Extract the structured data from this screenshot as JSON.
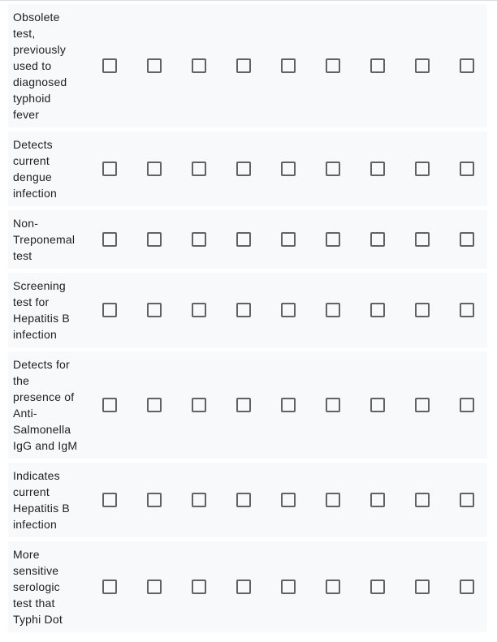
{
  "grid": {
    "column_count": 9,
    "rows": [
      {
        "label": "Obsolete test, previously used to diagnosed typhoid fever",
        "lines": [
          "Obsolete",
          "test,",
          "previously",
          "used to",
          "diagnosed",
          "typhoid",
          "fever"
        ],
        "checked": [
          false,
          false,
          false,
          false,
          false,
          false,
          false,
          false,
          false
        ]
      },
      {
        "label": "Detects current dengue infection",
        "lines": [
          "Detects",
          "current",
          "dengue",
          "infection"
        ],
        "checked": [
          false,
          false,
          false,
          false,
          false,
          false,
          false,
          false,
          false
        ]
      },
      {
        "label": "Non-Treponemal test",
        "lines": [
          "Non-",
          "Treponemal",
          "test"
        ],
        "checked": [
          false,
          false,
          false,
          false,
          false,
          false,
          false,
          false,
          false
        ]
      },
      {
        "label": "Screening test for Hepatitis B infection",
        "lines": [
          "Screening",
          "test for",
          "Hepatitis B",
          "infection"
        ],
        "checked": [
          false,
          false,
          false,
          false,
          false,
          false,
          false,
          false,
          false
        ]
      },
      {
        "label": "Detects for the presence of Anti-Salmonella IgG and IgM",
        "lines": [
          "Detects for",
          "the",
          "presence of",
          "Anti-",
          "Salmonella",
          "IgG and IgM"
        ],
        "checked": [
          false,
          false,
          false,
          false,
          false,
          false,
          false,
          false,
          false
        ]
      },
      {
        "label": "Indicates current Hepatitis B infection",
        "lines": [
          "Indicates",
          "current",
          "Hepatitis B",
          "infection"
        ],
        "checked": [
          false,
          false,
          false,
          false,
          false,
          false,
          false,
          false,
          false
        ]
      },
      {
        "label": "More sensitive serologic test that Typhi Dot",
        "lines": [
          "More",
          "sensitive",
          "serologic",
          "test that",
          "Typhi Dot"
        ],
        "checked": [
          false,
          false,
          false,
          false,
          false,
          false,
          false,
          false,
          false
        ]
      }
    ]
  },
  "colors": {
    "row_background": "#f8f9fa",
    "checkbox_border": "#5f6368",
    "text": "#202124"
  }
}
